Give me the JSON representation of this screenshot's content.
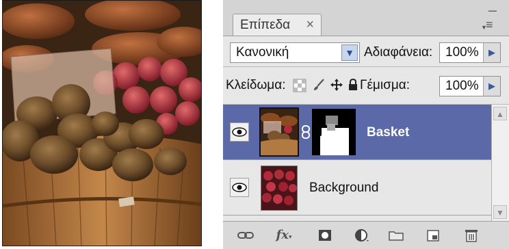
{
  "panel": {
    "tab_label": "Επίπεδα",
    "close_glyph": "×",
    "minimize_glyph": "–",
    "menu_glyph": "≡"
  },
  "blend": {
    "mode_value": "Κανονική",
    "opacity_label": "Αδιαφάνεια:",
    "opacity_value": "100%"
  },
  "lock": {
    "label": "Κλείδωμα:",
    "fill_label": "Γέμισμα:",
    "fill_value": "100%",
    "icons": [
      "lock-transparent-pixels-icon",
      "lock-image-pixels-icon",
      "lock-position-icon",
      "lock-all-icon"
    ]
  },
  "layers": [
    {
      "name": "Basket",
      "selected": true,
      "has_mask": true
    },
    {
      "name": "Background",
      "selected": false,
      "has_mask": false
    }
  ],
  "bottom_bar": {
    "icons": [
      "link-layers-icon",
      "layer-style-fx-icon",
      "add-mask-icon",
      "adjustment-layer-icon",
      "new-group-icon",
      "new-layer-icon",
      "delete-layer-icon"
    ],
    "fx_label": "fx"
  },
  "colors": {
    "selected_row": "#5b69a9",
    "panel_bg": "#e7e7e7"
  }
}
